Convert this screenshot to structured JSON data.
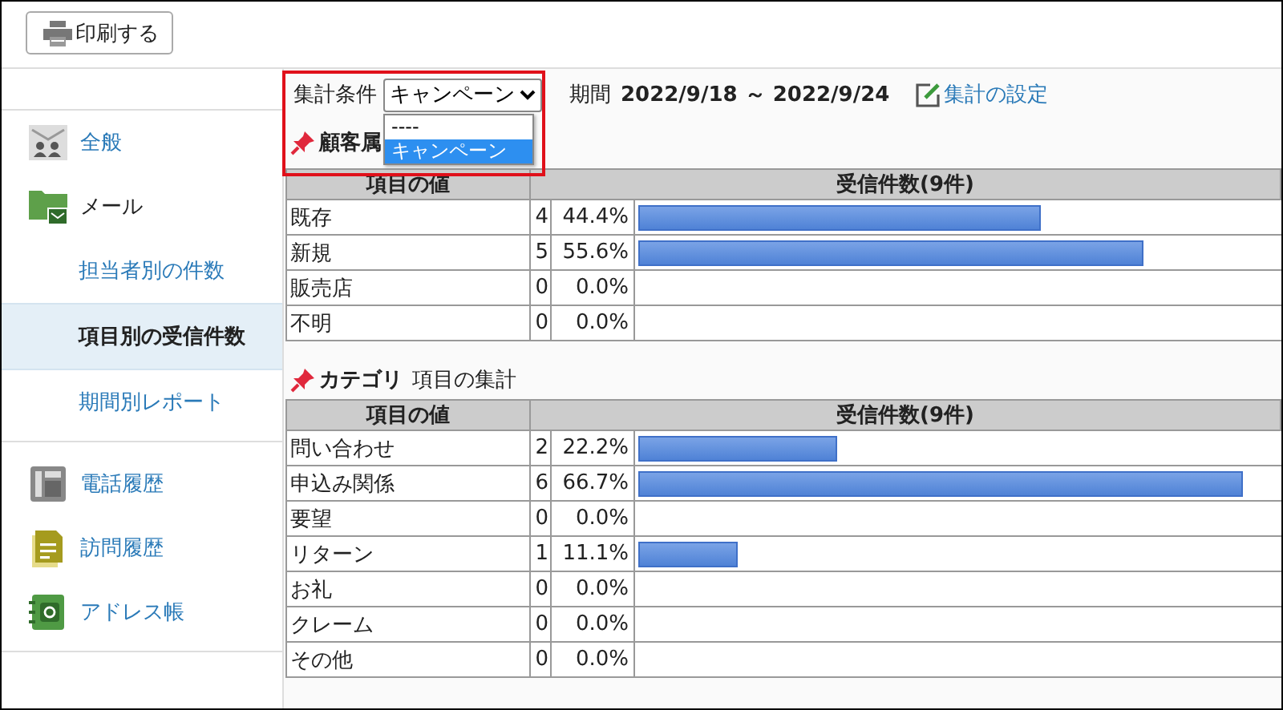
{
  "toolbar": {
    "print_button": "印刷する"
  },
  "sidebar": {
    "items": [
      {
        "kind": "general",
        "label": "全般",
        "selected": false
      },
      {
        "kind": "mail",
        "label": "メール",
        "selected": false
      },
      {
        "kind": "sub",
        "label": "担当者別の件数",
        "selected": false
      },
      {
        "kind": "sub",
        "label": "項目別の受信件数",
        "selected": true
      },
      {
        "kind": "sub",
        "label": "期間別レポート",
        "selected": false
      },
      {
        "kind": "phone",
        "label": "電話履歴",
        "selected": false
      },
      {
        "kind": "visit",
        "label": "訪問履歴",
        "selected": false
      },
      {
        "kind": "address",
        "label": "アドレス帳",
        "selected": false
      }
    ]
  },
  "filter": {
    "label": "集計条件",
    "value": "キャンペーン",
    "options": [
      {
        "label": "----",
        "selected": false
      },
      {
        "label": "キャンペーン",
        "selected": true
      }
    ]
  },
  "period": {
    "label": "期間",
    "value": "2022/9/18 ～ 2022/9/24"
  },
  "settings_link": "集計の設定",
  "sections": [
    {
      "title": "顧客属",
      "columns": [
        "項目の値",
        "受信件数(9件)"
      ],
      "rows": [
        {
          "label": "既存",
          "count": "4",
          "percent": "44.4%",
          "level": 0.63
        },
        {
          "label": "新規",
          "count": "5",
          "percent": "55.6%",
          "level": 0.79
        },
        {
          "label": "販売店",
          "count": "0",
          "percent": "0.0%"
        },
        {
          "label": "不明",
          "count": "0",
          "percent": "0.0%"
        }
      ]
    },
    {
      "title": "カテゴリ",
      "subtitle": "項目の集計",
      "columns": [
        "項目の値",
        "受信件数(9件)"
      ],
      "rows": [
        {
          "label": "問い合わせ",
          "count": "2",
          "percent": "22.2%",
          "level": 0.31
        },
        {
          "label": "申込み関係",
          "count": "6",
          "percent": "66.7%",
          "level": 0.945
        },
        {
          "label": "要望",
          "count": "0",
          "percent": "0.0%"
        },
        {
          "label": "リターン",
          "count": "1",
          "percent": "11.1%",
          "level": 0.156
        },
        {
          "label": "お礼",
          "count": "0",
          "percent": "0.0%"
        },
        {
          "label": "クレーム",
          "count": "0",
          "percent": "0.0%"
        },
        {
          "label": "その他",
          "count": "0",
          "percent": "0.0%"
        }
      ]
    }
  ]
}
